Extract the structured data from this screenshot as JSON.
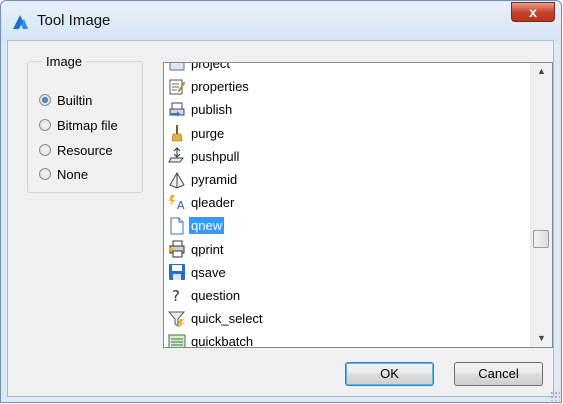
{
  "window": {
    "title": "Tool Image",
    "close_label": "x"
  },
  "image_group": {
    "legend": "Image",
    "options": [
      {
        "label": "Builtin",
        "selected": true
      },
      {
        "label": "Bitmap file",
        "selected": false
      },
      {
        "label": "Resource",
        "selected": false
      },
      {
        "label": "None",
        "selected": false
      }
    ]
  },
  "icon_list": {
    "items": [
      {
        "label": "project",
        "icon": "project-icon"
      },
      {
        "label": "properties",
        "icon": "properties-icon"
      },
      {
        "label": "publish",
        "icon": "publish-icon"
      },
      {
        "label": "purge",
        "icon": "purge-icon"
      },
      {
        "label": "pushpull",
        "icon": "pushpull-icon"
      },
      {
        "label": "pyramid",
        "icon": "pyramid-icon"
      },
      {
        "label": "qleader",
        "icon": "qleader-icon"
      },
      {
        "label": "qnew",
        "icon": "qnew-icon",
        "selected": true
      },
      {
        "label": "qprint",
        "icon": "qprint-icon"
      },
      {
        "label": "qsave",
        "icon": "qsave-icon"
      },
      {
        "label": "question",
        "icon": "question-icon"
      },
      {
        "label": "quick_select",
        "icon": "quick-select-icon"
      },
      {
        "label": "quickbatch",
        "icon": "quickbatch-icon"
      }
    ],
    "scroll_position": 0.62
  },
  "buttons": {
    "ok": "OK",
    "cancel": "Cancel"
  },
  "colors": {
    "selection": "#3399ff",
    "close_button": "#c7452b"
  }
}
